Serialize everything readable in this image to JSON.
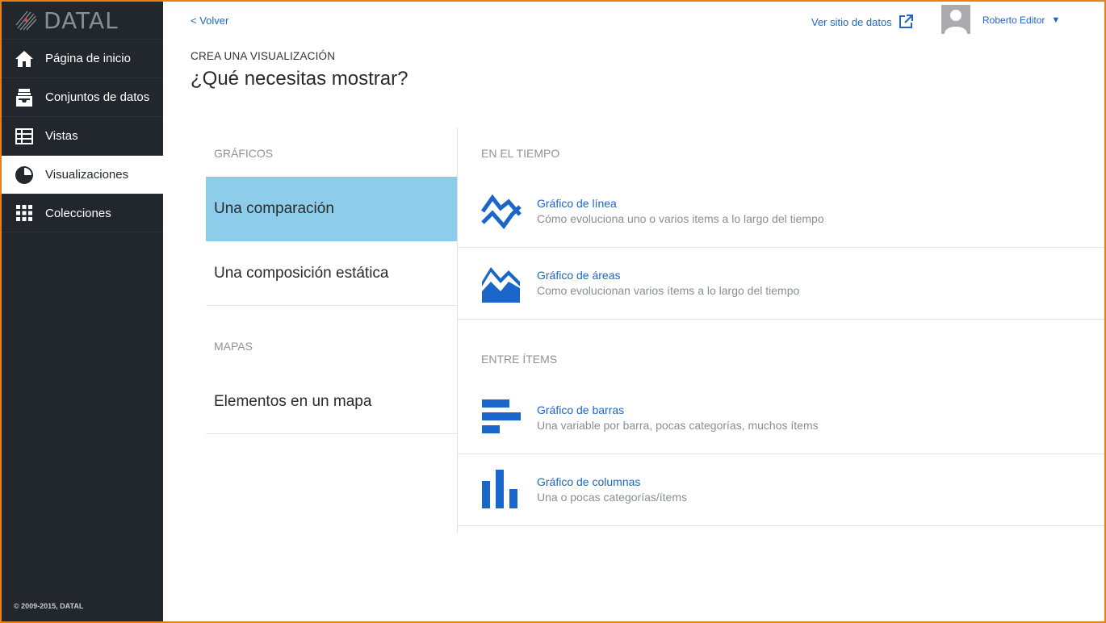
{
  "sidebar": {
    "logo_text": "DATAL",
    "items": [
      {
        "label": "Página de inicio",
        "icon": "home-icon"
      },
      {
        "label": "Conjuntos de datos",
        "icon": "inbox-icon"
      },
      {
        "label": "Vistas",
        "icon": "table-icon"
      },
      {
        "label": "Visualizaciones",
        "icon": "pie-chart-icon",
        "active": true
      },
      {
        "label": "Colecciones",
        "icon": "grid-icon"
      }
    ],
    "copyright": "© 2009-2015, DATAL"
  },
  "header": {
    "back_label": "< Volver",
    "site_link_label": "Ver sitio de datos",
    "user_name": "Roberto Editor",
    "caret": "▼"
  },
  "page": {
    "kicker": "CREA UNA VISUALIZACIÓN",
    "title": "¿Qué necesitas mostrar?"
  },
  "categories": {
    "charts_label": "GRÁFICOS",
    "charts": [
      "Una comparación",
      "Una composición estática"
    ],
    "maps_label": "MAPAS",
    "maps": [
      "Elementos en un mapa"
    ]
  },
  "options": {
    "time_label": "EN EL TIEMPO",
    "time_items": [
      {
        "title": "Gráfico de línea",
        "desc": "Cómo evoluciona uno o varios items a lo largo del tiempo",
        "icon": "line-chart-icon"
      },
      {
        "title": "Gráfico de áreas",
        "desc": "Como evolucionan varios ítems a lo largo del tiempo",
        "icon": "area-chart-icon"
      }
    ],
    "between_label": "ENTRE ÍTEMS",
    "between_items": [
      {
        "title": "Gráfico de barras",
        "desc": "Una variable por barra, pocas categorías, muchos ítems",
        "icon": "bar-chart-icon"
      },
      {
        "title": "Gráfico de columnas",
        "desc": "Una o pocas categorías/ítems",
        "icon": "column-chart-icon"
      }
    ]
  },
  "colors": {
    "accent": "#1a66c9",
    "sidebar_bg": "#22262d",
    "selected_bg": "#8ecde9",
    "frame": "#e8801a"
  }
}
